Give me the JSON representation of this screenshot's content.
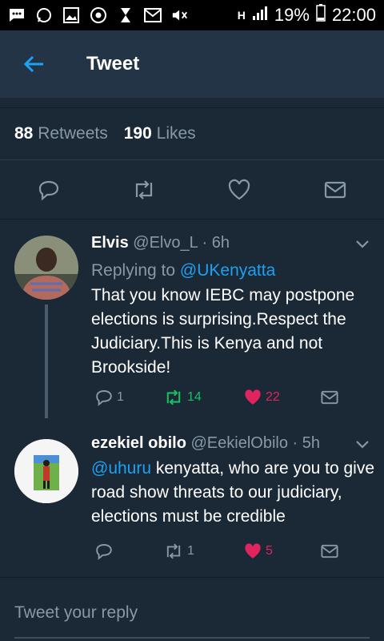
{
  "status_bar": {
    "battery": "19%",
    "time": "22:00",
    "network": "H"
  },
  "header": {
    "title": "Tweet"
  },
  "stats": {
    "retweets_count": "88",
    "retweets_label": "Retweets",
    "likes_count": "190",
    "likes_label": "Likes"
  },
  "replies": [
    {
      "name": "Elvis",
      "handle": "@Elvo_L",
      "time": "· 6h",
      "replying_prefix": "Replying to ",
      "replying_to": "@UKenyatta",
      "text": "That you know IEBC may postpone elections is surprising.Respect the Judiciary.This is Kenya and not Brookside!",
      "reply_count": "1",
      "retweet_count": "14",
      "like_count": "22"
    },
    {
      "name": "ezekiel obilo",
      "handle": "@EekielObilo",
      "time": "· 5h",
      "mention": "@uhuru",
      "text": " kenyatta, who are you to give road show threats to our judiciary, elections must be credible",
      "reply_count": "",
      "retweet_count": "1",
      "like_count": "5"
    }
  ],
  "composer": {
    "placeholder": "Tweet your reply"
  },
  "colors": {
    "background": "#1b2836",
    "accent": "#1da1f2",
    "retweet_green": "#17bf63",
    "like_red": "#e0245e",
    "muted": "#8899a6"
  }
}
